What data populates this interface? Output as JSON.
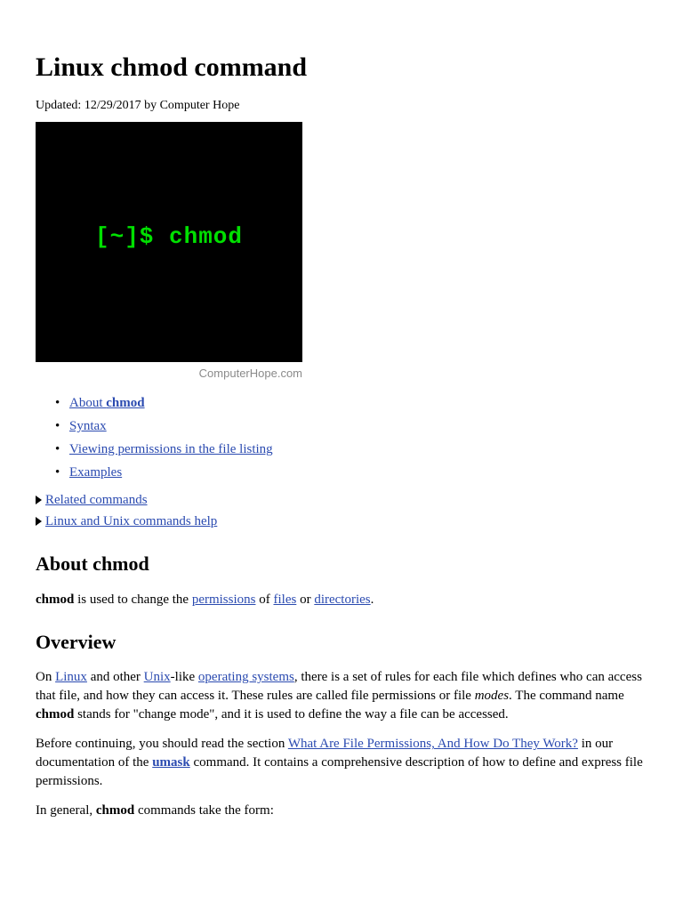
{
  "title": "Linux chmod command",
  "meta": "Updated: 12/29/2017 by Computer Hope",
  "terminal_prompt": "[~]$ chmod",
  "caption": "ComputerHope.com",
  "toc": [
    {
      "prefix": "About ",
      "bold": "chmod"
    },
    {
      "text": "Syntax"
    },
    {
      "text": "Viewing permissions in the file listing"
    },
    {
      "text": "Examples"
    }
  ],
  "related": [
    "Related commands",
    "Linux and Unix commands help"
  ],
  "about": {
    "heading": "About chmod",
    "p1_a": "chmod",
    "p1_b": " is used to change the ",
    "p1_link1": "permissions",
    "p1_c": " of ",
    "p1_link2": "files",
    "p1_d": " or ",
    "p1_link3": "directories",
    "p1_e": "."
  },
  "overview": {
    "heading": "Overview",
    "p1_a": "On ",
    "p1_linux": "Linux",
    "p1_b": " and other ",
    "p1_unix": "Unix",
    "p1_c": "-like ",
    "p1_os": "operating systems",
    "p1_d": ", there is a set of rules for each file which defines who can access that file, and how they can access it. These rules are called file permissions or file ",
    "p1_modes": "modes",
    "p1_e": ". The command name ",
    "p1_chmod": "chmod",
    "p1_f": " stands for \"change mode\", and it is used to define the way a file can be accessed.",
    "p2_a": "Before continuing, you should read the section ",
    "p2_link": "What Are File Permissions, And How Do They Work?",
    "p2_b": " in our documentation of the ",
    "p2_umask": "umask",
    "p2_c": " command. It contains a comprehensive description of how to define and express file permissions.",
    "p3_a": "In general, ",
    "p3_chmod": "chmod",
    "p3_b": " commands take the form:"
  }
}
